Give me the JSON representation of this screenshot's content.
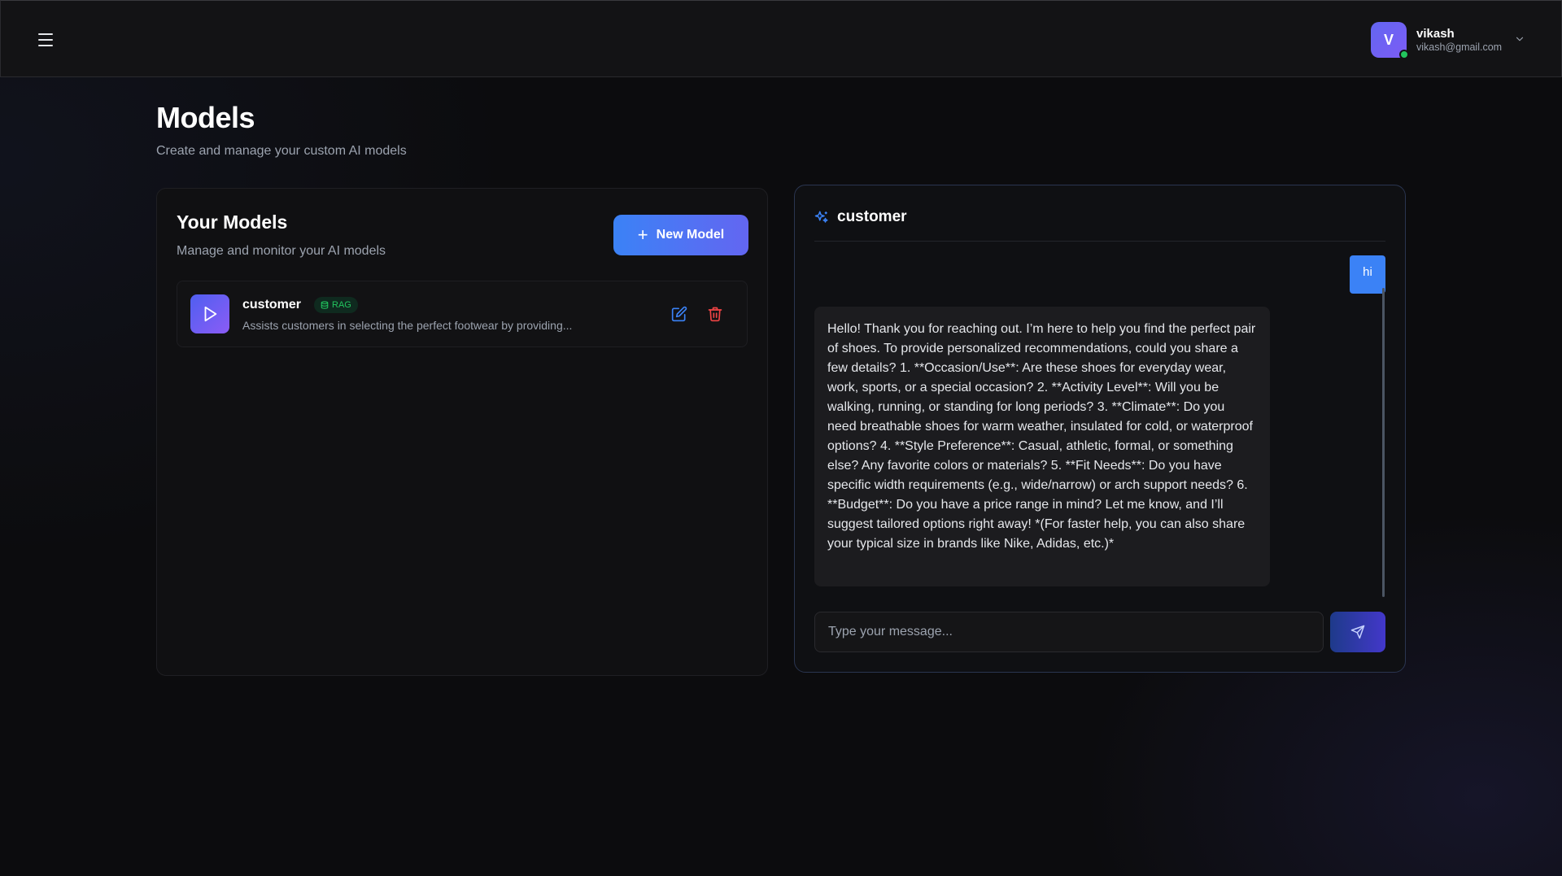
{
  "header": {
    "menu_icon": "hamburger-menu-icon",
    "user": {
      "initial": "V",
      "name": "vikash",
      "email": "vikash@gmail.com",
      "status": "online"
    },
    "dropdown_icon": "chevron-down-icon"
  },
  "page": {
    "title": "Models",
    "subtitle": "Create and manage your custom AI models"
  },
  "models_panel": {
    "title": "Your Models",
    "subtitle": "Manage and monitor your AI models",
    "new_button_label": "New Model",
    "models": [
      {
        "name": "customer",
        "badge": "RAG",
        "description": "Assists customers in selecting the perfect footwear by providing..."
      }
    ]
  },
  "chat": {
    "title": "customer",
    "messages": [
      {
        "role": "user",
        "text": "hi"
      },
      {
        "role": "assistant",
        "text": "Hello! Thank you for reaching out. I’m here to help you find the perfect pair of shoes. To provide personalized recommendations, could you share a few details? 1. **Occasion/Use**: Are these shoes for everyday wear, work, sports, or a special occasion? 2. **Activity Level**: Will you be walking, running, or standing for long periods? 3. **Climate**: Do you need breathable shoes for warm weather, insulated for cold, or waterproof options? 4. **Style Preference**: Casual, athletic, formal, or something else? Any favorite colors or materials? 5. **Fit Needs**: Do you have specific width requirements (e.g., wide/narrow) or arch support needs? 6. **Budget**: Do you have a price range in mind? Let me know, and I’ll suggest tailored options right away! *(For faster help, you can also share your typical size in brands like Nike, Adidas, etc.)*"
      }
    ],
    "input_placeholder": "Type your message...",
    "input_value": ""
  },
  "colors": {
    "accent": "#3b82f6",
    "accent_purple": "#6366f1",
    "rag_green": "#22c55e",
    "delete_red": "#ef4444",
    "background": "#0c0c0e"
  }
}
